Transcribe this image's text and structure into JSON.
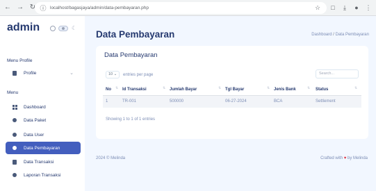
{
  "browser": {
    "url": "localhost/bagasjaya/admin/data-pembayaran.php",
    "icons": [
      "back-arrow-icon",
      "forward-arrow-icon",
      "reload-icon",
      "site-info-icon",
      "star-icon",
      "extensions-icon",
      "download-icon",
      "profile-icon",
      "menu-dots-icon"
    ]
  },
  "sidebar": {
    "brand": "admin",
    "profile_section": "Menu Profile",
    "profile_item": "Profile",
    "menu_section": "Menu",
    "items": [
      {
        "label": "Dashboard",
        "icon": "grid-icon"
      },
      {
        "label": "Data Paket",
        "icon": "dot-icon"
      },
      {
        "label": "Data User",
        "icon": "dot-icon"
      },
      {
        "label": "Data Pembayaran",
        "icon": "dot-icon",
        "active": true
      },
      {
        "label": "Data Transaksi",
        "icon": "doc-icon"
      },
      {
        "label": "Laporan Transaksi",
        "icon": "dot-icon"
      }
    ],
    "active_color": "#435ebe"
  },
  "header": {
    "title": "Data Pembayaran",
    "breadcrumb_home": "Dashboard",
    "breadcrumb_sep": "/",
    "breadcrumb_current": "Data Pembayaran"
  },
  "card": {
    "title": "Data Pembayaran",
    "per_page_value": "10",
    "per_page_text": "entries per page",
    "search_placeholder": "Search...",
    "columns": [
      "No",
      "Id Transaksi",
      "Jumlah Bayar",
      "Tgl Bayar",
      "Jenis Bank",
      "Status"
    ],
    "rows": [
      {
        "no": "1",
        "id_transaksi": "TR-001",
        "jumlah_bayar": "500000",
        "tgl_bayar": "06-27-2024",
        "jenis_bank": "BCA",
        "status": "Settlement"
      }
    ],
    "showing": "Showing 1 to 1 of 1 entries"
  },
  "footer": {
    "left": "2024 © Melinda",
    "right_prefix": "Crafted with",
    "right_suffix": "by Melinda",
    "heart_color": "#dc3545"
  }
}
